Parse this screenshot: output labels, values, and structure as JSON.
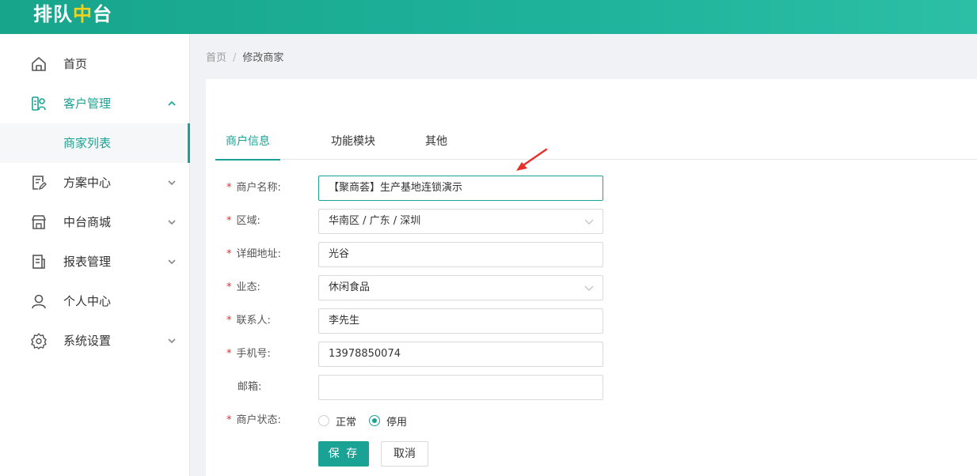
{
  "header": {
    "logo_prefix": "排队",
    "logo_accent": "中",
    "logo_suffix": "台"
  },
  "sidebar": {
    "items": [
      {
        "label": "首页",
        "icon": "home-icon"
      },
      {
        "label": "客户管理",
        "icon": "customer-icon",
        "open": true,
        "children": [
          {
            "label": "商家列表",
            "active": true
          }
        ]
      },
      {
        "label": "方案中心",
        "icon": "edit-doc-icon"
      },
      {
        "label": "中台商城",
        "icon": "store-icon"
      },
      {
        "label": "报表管理",
        "icon": "report-icon"
      },
      {
        "label": "个人中心",
        "icon": "user-icon"
      },
      {
        "label": "系统设置",
        "icon": "gear-icon"
      }
    ]
  },
  "breadcrumb": {
    "home": "首页",
    "separator": "/",
    "current": "修改商家"
  },
  "tabs": [
    {
      "label": "商户信息",
      "active": true
    },
    {
      "label": "功能模块"
    },
    {
      "label": "其他"
    }
  ],
  "form": {
    "merchant_name": {
      "label": "商户名称:",
      "value": "【聚商荟】生产基地连锁演示",
      "required": true
    },
    "region": {
      "label": "区域:",
      "value": "华南区 / 广东 / 深圳",
      "required": true
    },
    "address": {
      "label": "详细地址:",
      "value": "光谷",
      "required": true
    },
    "business_type": {
      "label": "业态:",
      "value": "休闲食品",
      "required": true
    },
    "contact": {
      "label": "联系人:",
      "value": "李先生",
      "required": true
    },
    "phone": {
      "label": "手机号:",
      "value": "13978850074",
      "required": true
    },
    "email": {
      "label": "邮箱:",
      "value": "",
      "required": false
    },
    "status": {
      "label": "商户状态:",
      "required": true,
      "options": [
        {
          "label": "正常",
          "checked": false
        },
        {
          "label": "停用",
          "checked": true
        }
      ]
    },
    "save_label": "保 存",
    "cancel_label": "取消",
    "required_mark": "*"
  },
  "colors": {
    "primary": "#1aa394",
    "header_start": "#17a58c",
    "header_end": "#2cbfa6",
    "required": "#f5222d",
    "annotation_arrow": "#e8302a"
  }
}
